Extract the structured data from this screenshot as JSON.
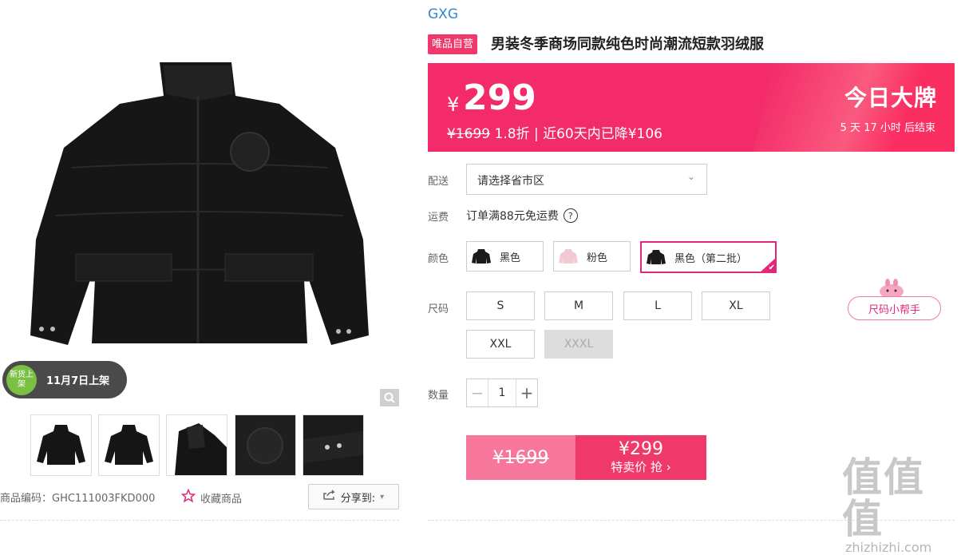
{
  "brand": "GXG",
  "badge_vip": "唯品自营",
  "product_title": "男装冬季商场同款纯色时尚潮流短款羽绒服",
  "price": {
    "currency": "¥",
    "current": "299",
    "original": "¥1699",
    "discount": "1.8折",
    "sep": "|",
    "drop_text": "近60天内已降¥106"
  },
  "promo": {
    "title": "今日大牌",
    "countdown": "5 天 17 小时 后结束"
  },
  "delivery": {
    "label": "配送",
    "placeholder": "请选择省市区",
    "chevron": "⌄"
  },
  "shipping": {
    "label": "运费",
    "text": "订单满88元免运费",
    "help": "?"
  },
  "colors": {
    "label": "颜色",
    "options": [
      {
        "name": "黑色",
        "swatch": "#1a1a1a"
      },
      {
        "name": "粉色",
        "swatch": "#f3c9d3"
      },
      {
        "name": "黑色（第二批）",
        "swatch": "#1a1a1a"
      }
    ],
    "selected_index": 2,
    "check": "✔"
  },
  "sizes": {
    "label": "尺码",
    "options": [
      "S",
      "M",
      "L",
      "XL",
      "XXL",
      "XXXL"
    ],
    "disabled": [
      "XXXL"
    ],
    "helper": "尺码小帮手"
  },
  "quantity": {
    "label": "数量",
    "value": "1",
    "minus": "−",
    "plus": "+"
  },
  "buy": {
    "original": "¥1699",
    "price": "¥299",
    "action": "特卖价 抢"
  },
  "gallery": {
    "new_badge": "新货上架",
    "new_date": "11月7日上架"
  },
  "meta": {
    "code": "商品编码：GHC111003FKD000",
    "favorite": "收藏商品",
    "share": "分享到:",
    "share_caret": "▾"
  },
  "watermark": {
    "logo": "值值值",
    "site": "zhizhizhi.com"
  },
  "colors_theme": {
    "primary": "#f32b6a",
    "accent": "#e3277b",
    "brand_link": "#2f86d6"
  }
}
